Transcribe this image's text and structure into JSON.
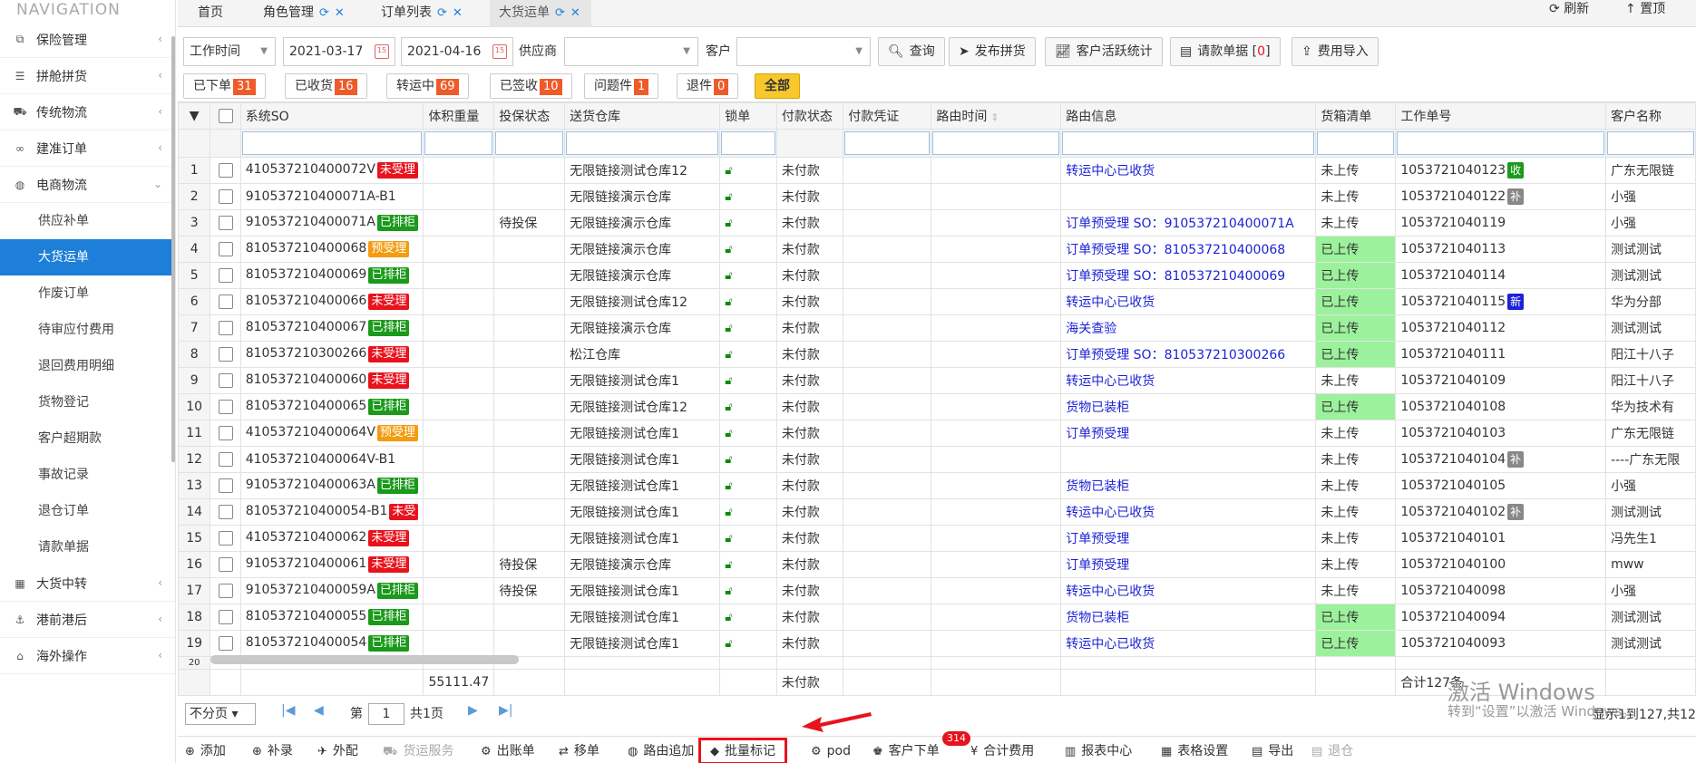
{
  "sidebar": {
    "title": "NAVIGATION",
    "menus": [
      {
        "label": "保险管理",
        "icon": "insurance-icon"
      },
      {
        "label": "拼舱拼货",
        "icon": "list-icon"
      },
      {
        "label": "传统物流",
        "icon": "truck-icon"
      },
      {
        "label": "建准订单",
        "icon": "link-icon"
      },
      {
        "label": "电商物流",
        "icon": "globe-icon"
      }
    ],
    "subitems": [
      "供应补单",
      "大货运单",
      "作废订单",
      "待审应付费用",
      "退回费用明细",
      "货物登记",
      "客户超期款",
      "事故记录",
      "退仓订单",
      "请款单据"
    ],
    "menus2": [
      {
        "label": "大货中转",
        "icon": "grid-icon"
      },
      {
        "label": "港前港后",
        "icon": "ship-icon"
      },
      {
        "label": "海外操作",
        "icon": "building-icon"
      }
    ]
  },
  "tabs": [
    {
      "label": "首页"
    },
    {
      "label": "角色管理"
    },
    {
      "label": "订单列表"
    },
    {
      "label": "大货运单"
    }
  ],
  "top_actions": {
    "refresh": "刷新",
    "top": "置顶"
  },
  "filters": {
    "time_type": "工作时间",
    "date_from": "2021-03-17",
    "date_to": "2021-04-16",
    "supplier_label": "供应商",
    "customer_label": "客户",
    "query": "查询",
    "publish": "发布拼货",
    "stats": "客户活跃统计",
    "invoice": "请款单据",
    "invoice_count": "0",
    "import_fee": "费用导入"
  },
  "status_buttons": [
    {
      "label": "已下单",
      "count": "31"
    },
    {
      "label": "已收货",
      "count": "16"
    },
    {
      "label": "转运中",
      "count": "69"
    },
    {
      "label": "已签收",
      "count": "10"
    },
    {
      "label": "问题件",
      "count": "1"
    },
    {
      "label": "退件",
      "count": "0"
    }
  ],
  "status_all": "全部",
  "columns": [
    "系统SO",
    "体积重量",
    "投保状态",
    "送货仓库",
    "锁单",
    "付款状态",
    "付款凭证",
    "路由时间",
    "路由信息",
    "货箱清单",
    "工作单号",
    "客户名称"
  ],
  "rows": [
    {
      "n": "1",
      "so": "410537210400072V",
      "tag": "未受理",
      "ins": "",
      "wh": "无限链接测试仓库12",
      "pay": "未付款",
      "route": "转运中心已收货",
      "box": "未上传",
      "boxg": false,
      "job": "1053721040123",
      "jb": "收",
      "cust": "广东无限链"
    },
    {
      "n": "2",
      "so": "910537210400071A-B1",
      "tag": "",
      "ins": "",
      "wh": "无限链接演示仓库",
      "pay": "未付款",
      "route": "",
      "box": "未上传",
      "boxg": false,
      "job": "1053721040122",
      "jb": "补",
      "cust": "小强"
    },
    {
      "n": "3",
      "so": "910537210400071A",
      "tag": "已排柜",
      "ins": "待投保",
      "wh": "无限链接演示仓库",
      "pay": "未付款",
      "route": "订单预受理 SO：910537210400071A",
      "box": "未上传",
      "boxg": false,
      "job": "1053721040119",
      "jb": "",
      "cust": "小强"
    },
    {
      "n": "4",
      "so": "810537210400068",
      "tag": "预受理",
      "ins": "",
      "wh": "无限链接演示仓库",
      "pay": "未付款",
      "route": "订单预受理 SO：810537210400068",
      "box": "已上传",
      "boxg": true,
      "job": "1053721040113",
      "jb": "",
      "cust": "测试测试"
    },
    {
      "n": "5",
      "so": "810537210400069",
      "tag": "已排柜",
      "ins": "",
      "wh": "无限链接演示仓库",
      "pay": "未付款",
      "route": "订单预受理 SO：810537210400069",
      "box": "已上传",
      "boxg": true,
      "job": "1053721040114",
      "jb": "",
      "cust": "测试测试"
    },
    {
      "n": "6",
      "so": "810537210400066",
      "tag": "未受理",
      "ins": "",
      "wh": "无限链接测试仓库12",
      "pay": "未付款",
      "route": "转运中心已收货",
      "box": "已上传",
      "boxg": true,
      "job": "1053721040115",
      "jb": "新",
      "cust": "华为分部"
    },
    {
      "n": "7",
      "so": "810537210400067",
      "tag": "已排柜",
      "ins": "",
      "wh": "无限链接演示仓库",
      "pay": "未付款",
      "route": "海关查验",
      "box": "已上传",
      "boxg": true,
      "job": "1053721040112",
      "jb": "",
      "cust": "测试测试"
    },
    {
      "n": "8",
      "so": "810537210300266",
      "tag": "未受理",
      "ins": "",
      "wh": "松江仓库",
      "pay": "未付款",
      "route": "订单预受理 SO：810537210300266",
      "box": "已上传",
      "boxg": true,
      "job": "1053721040111",
      "jb": "",
      "cust": "阳江十八子"
    },
    {
      "n": "9",
      "so": "810537210400060",
      "tag": "未受理",
      "ins": "",
      "wh": "无限链接测试仓库1",
      "pay": "未付款",
      "route": "转运中心已收货",
      "box": "未上传",
      "boxg": false,
      "job": "1053721040109",
      "jb": "",
      "cust": "阳江十八子"
    },
    {
      "n": "10",
      "so": "810537210400065",
      "tag": "已排柜",
      "ins": "",
      "wh": "无限链接测试仓库12",
      "pay": "未付款",
      "route": "货物已装柜",
      "box": "已上传",
      "boxg": true,
      "job": "1053721040108",
      "jb": "",
      "cust": "华为技术有"
    },
    {
      "n": "11",
      "so": "410537210400064V",
      "tag": "预受理",
      "ins": "",
      "wh": "无限链接测试仓库1",
      "pay": "未付款",
      "route": "订单预受理",
      "box": "未上传",
      "boxg": false,
      "job": "1053721040103",
      "jb": "",
      "cust": "广东无限链"
    },
    {
      "n": "12",
      "so": "410537210400064V-B1",
      "tag": "",
      "ins": "",
      "wh": "无限链接测试仓库1",
      "pay": "未付款",
      "route": "",
      "box": "未上传",
      "boxg": false,
      "job": "1053721040104",
      "jb": "补",
      "cust": "----广东无限"
    },
    {
      "n": "13",
      "so": "910537210400063A",
      "tag": "已排柜",
      "ins": "",
      "wh": "无限链接测试仓库1",
      "pay": "未付款",
      "route": "货物已装柜",
      "box": "未上传",
      "boxg": false,
      "job": "1053721040105",
      "jb": "",
      "cust": "小强"
    },
    {
      "n": "14",
      "so": "810537210400054-B1",
      "tag": "未受",
      "ins": "",
      "wh": "无限链接测试仓库1",
      "pay": "未付款",
      "route": "转运中心已收货",
      "box": "未上传",
      "boxg": false,
      "job": "1053721040102",
      "jb": "补",
      "cust": "测试测试"
    },
    {
      "n": "15",
      "so": "410537210400062",
      "tag": "未受理",
      "ins": "",
      "wh": "无限链接测试仓库1",
      "pay": "未付款",
      "route": "订单预受理",
      "box": "未上传",
      "boxg": false,
      "job": "1053721040101",
      "jb": "",
      "cust": "冯先生1"
    },
    {
      "n": "16",
      "so": "910537210400061",
      "tag": "未受理",
      "ins": "待投保",
      "wh": "无限链接演示仓库",
      "pay": "未付款",
      "route": "订单预受理",
      "box": "未上传",
      "boxg": false,
      "job": "1053721040100",
      "jb": "",
      "cust": "mww"
    },
    {
      "n": "17",
      "so": "910537210400059A",
      "tag": "已排柜",
      "ins": "待投保",
      "wh": "无限链接测试仓库1",
      "pay": "未付款",
      "route": "转运中心已收货",
      "box": "未上传",
      "boxg": false,
      "job": "1053721040098",
      "jb": "",
      "cust": "小强"
    },
    {
      "n": "18",
      "so": "810537210400055",
      "tag": "已排柜",
      "ins": "",
      "wh": "无限链接测试仓库1",
      "pay": "未付款",
      "route": "货物已装柜",
      "box": "已上传",
      "boxg": true,
      "job": "1053721040094",
      "jb": "",
      "cust": "测试测试"
    },
    {
      "n": "19",
      "so": "810537210400054",
      "tag": "已排柜",
      "ins": "",
      "wh": "无限链接测试仓库1",
      "pay": "未付款",
      "route": "转运中心已收货",
      "box": "已上传",
      "boxg": true,
      "job": "1053721040093",
      "jb": "",
      "cust": "测试测试"
    }
  ],
  "footer": {
    "weight_total": "55111.47",
    "pay": "未付款",
    "total": "合计127条"
  },
  "pager": {
    "size": "不分页",
    "page_prefix": "第",
    "page": "1",
    "page_suffix": "共1页",
    "showing": "显示1到127,共12"
  },
  "watermark": {
    "line1": "激活 Windows",
    "line2": "转到“设置”以激活 Windows。"
  },
  "toolbar": [
    {
      "label": "添加",
      "icon": "plus-icon",
      "disabled": false
    },
    {
      "label": "补录",
      "icon": "plus-icon",
      "disabled": false
    },
    {
      "label": "外配",
      "icon": "rocket-icon",
      "disabled": false
    },
    {
      "label": "货运服务",
      "icon": "truck-icon",
      "disabled": true
    },
    {
      "label": "出账单",
      "icon": "gear-icon",
      "disabled": false
    },
    {
      "label": "移单",
      "icon": "retweet-icon",
      "disabled": false
    },
    {
      "label": "路由追加",
      "icon": "globe-icon",
      "disabled": false
    },
    {
      "label": "批量标记",
      "icon": "tag-icon",
      "disabled": false
    },
    {
      "label": "pod",
      "icon": "gear-icon",
      "disabled": false
    },
    {
      "label": "客户下单",
      "icon": "users-icon",
      "disabled": false
    },
    {
      "label": "合计费用",
      "icon": "yen-icon",
      "disabled": false
    },
    {
      "label": "报表中心",
      "icon": "chart-icon",
      "disabled": false
    },
    {
      "label": "表格设置",
      "icon": "table-icon",
      "disabled": false
    },
    {
      "label": "导出",
      "icon": "file-icon",
      "disabled": false
    },
    {
      "label": "退仓",
      "icon": "file-icon",
      "disabled": true
    }
  ],
  "customer_order_badge": "314",
  "colors": {
    "accent": "#1e7fd8",
    "tag_red": "#e8131d",
    "tag_green": "#1a9a1a",
    "tag_orange": "#f39c12",
    "uploaded": "#9cf29c",
    "link": "#1c22d8"
  }
}
